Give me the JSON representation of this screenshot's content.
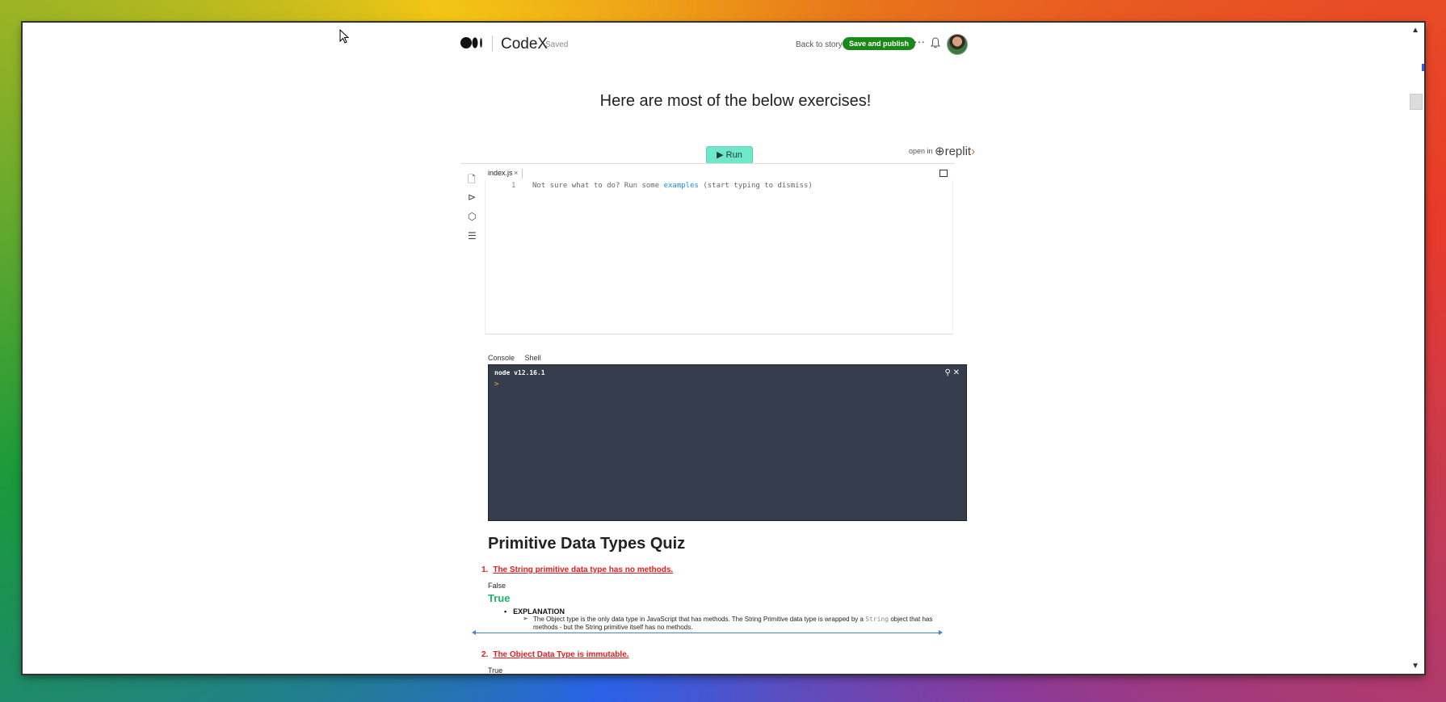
{
  "header": {
    "publication_name": "CodeX",
    "save_status": "Saved",
    "back_to_story": "Back to story",
    "publish_button": "Save and publish",
    "more_label": "···"
  },
  "story": {
    "heading": "Here are most of the below exercises!"
  },
  "repl": {
    "run_label": "Run",
    "open_in": "open in",
    "brand": "replit",
    "file_tab": "index.js",
    "line_number": "1",
    "hint_before": "Not sure what to do? Run some ",
    "hint_link": "examples",
    "hint_after": " (start typing to dismiss)",
    "console_tab": "Console",
    "shell_tab": "Shell",
    "node_version": "node v12.16.1",
    "prompt": ">"
  },
  "quiz": {
    "title": "Primitive Data Types Quiz",
    "q1_number": "1.",
    "q1_text": "The String primitive data type has no methods.",
    "q1_option_false": "False",
    "q1_option_true": "True",
    "explanation_label": "EXPLANATION",
    "explanation_part1": "The Object type is the only data type in JavaScript that has methods. The String Primitive data type is wrapped by a ",
    "explanation_code": "String",
    "explanation_part2": " object that has methods - but the String primitive itself has no methods.",
    "q2_number": "2.",
    "q2_text": "The Object Data Type is immutable.",
    "q2_option_true": "True"
  },
  "colors": {
    "publish_green": "#1a8917",
    "run_button": "#6ee8c8",
    "console_bg": "#363d4c",
    "question_red": "#e21d1d",
    "answer_green": "#1db26a"
  }
}
